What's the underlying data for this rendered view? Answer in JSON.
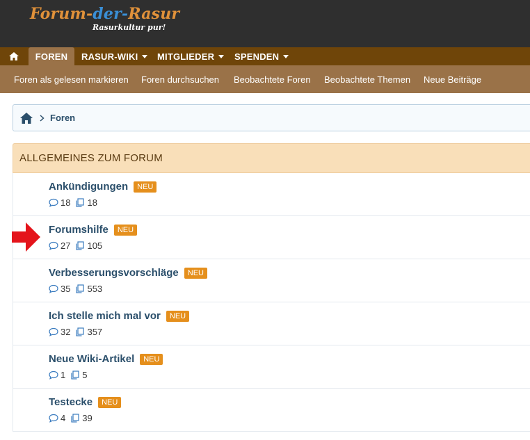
{
  "header": {
    "logo": {
      "part_a": "Forum-",
      "part_b": "der-",
      "part_c": "Rasur"
    },
    "tagline": "Rasurkultur pur!"
  },
  "nav": {
    "home_icon": "home-icon",
    "tabs": [
      {
        "label": "FOREN",
        "active": true,
        "dropdown": false
      },
      {
        "label": "RASUR-WIKI",
        "active": false,
        "dropdown": true
      },
      {
        "label": "MITGLIEDER",
        "active": false,
        "dropdown": true
      },
      {
        "label": "SPENDEN",
        "active": false,
        "dropdown": true
      }
    ]
  },
  "subnav": {
    "items": [
      "Foren als gelesen markieren",
      "Foren durchsuchen",
      "Beobachtete Foren",
      "Beobachtete Themen",
      "Neue Beiträge"
    ]
  },
  "breadcrumb": {
    "home_icon": "home-icon",
    "label": "Foren"
  },
  "category": {
    "title": "ALLGEMEINES ZUM FORUM",
    "badge_label": "NEU",
    "forums": [
      {
        "title": "Ankündigungen",
        "threads": "18",
        "posts": "18"
      },
      {
        "title": "Forumshilfe",
        "threads": "27",
        "posts": "105"
      },
      {
        "title": "Verbesserungsvorschläge",
        "threads": "35",
        "posts": "553"
      },
      {
        "title": "Ich stelle mich mal vor",
        "threads": "32",
        "posts": "357"
      },
      {
        "title": "Neue Wiki-Artikel",
        "threads": "1",
        "posts": "5"
      },
      {
        "title": "Testecke",
        "threads": "4",
        "posts": "39"
      }
    ]
  },
  "colors": {
    "header_bg": "#2f2f2f",
    "nav_bg": "#6f4509",
    "subnav_bg": "#9a7248",
    "category_bg": "#f9dfb9",
    "badge_bg": "#e58f1c",
    "link_color": "#2b4f6b",
    "arrow_color": "#e4141b"
  }
}
